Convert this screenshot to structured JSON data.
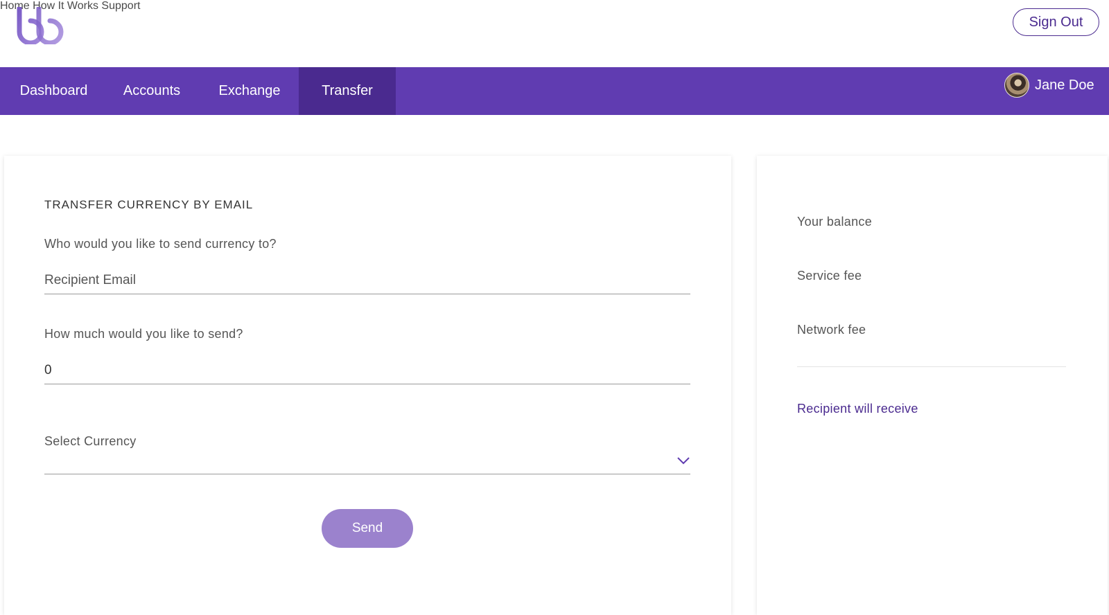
{
  "header": {
    "logo_text": "bb",
    "links": [
      {
        "label": "Home"
      },
      {
        "label": "How It Works"
      },
      {
        "label": "Support"
      }
    ],
    "sign_out_label": "Sign Out"
  },
  "nav": {
    "items": [
      {
        "label": "Dashboard"
      },
      {
        "label": "Accounts"
      },
      {
        "label": "Exchange"
      },
      {
        "label": "Transfer"
      }
    ],
    "active": "Transfer",
    "user_name": "Jane Doe"
  },
  "transfer": {
    "title": "TRANSFER CURRENCY BY EMAIL",
    "recipient_question": "Who would you like to send currency to?",
    "recipient_placeholder": "Recipient Email",
    "recipient_value": "",
    "amount_question": "How much would you like to send?",
    "amount_value": "0",
    "currency_label": "Select Currency",
    "currency_value": "",
    "send_label": "Send"
  },
  "summary": {
    "balance_label": "Your balance",
    "service_fee_label": "Service fee",
    "network_fee_label": "Network fee",
    "receive_label": "Recipient will receive"
  },
  "colors": {
    "brand_purple": "#603cb1",
    "active_tab": "#4a2a8f",
    "send_button": "#9b82cd",
    "accent_text": "#4a2a8f"
  }
}
